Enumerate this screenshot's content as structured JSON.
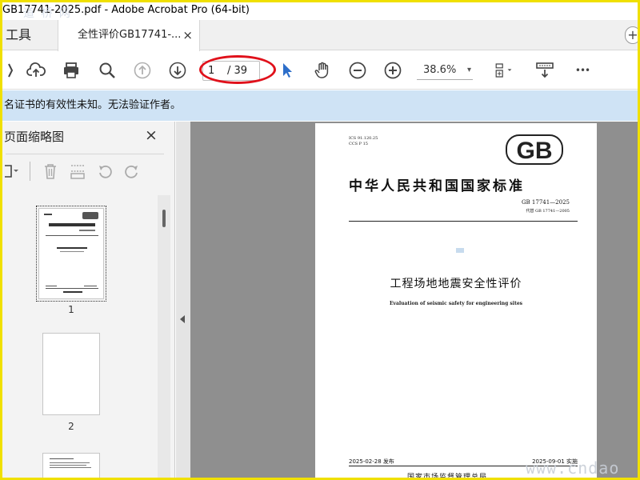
{
  "window": {
    "title": "GB17741-2025.pdf - Adobe Acrobat Pro (64-bit)",
    "watermark_top": "道 桥 网"
  },
  "tabs": {
    "tools_label": "工具",
    "doc_tab_label": "全性评价GB17741-...",
    "close_glyph": "×",
    "add_glyph": "+"
  },
  "toolbar": {
    "current_page": "1",
    "total_pages": "/ 39",
    "zoom": "38.6%",
    "caret": "▾",
    "more_glyph": "•••"
  },
  "infobar": {
    "message": "名证书的有效性未知。无法验证作者。"
  },
  "sidebar": {
    "title": "页面缩略图",
    "close_glyph": "×",
    "thumbnails": [
      {
        "label": "1"
      },
      {
        "label": "2"
      }
    ]
  },
  "document": {
    "ics": "ICS 91.120.25",
    "ccs": "CCS P 15",
    "logo_text": "GB",
    "standard_title": "中华人民共和国国家标准",
    "std_number": "GB 17741—2025",
    "replaces": "代替 GB 17741—2005",
    "title_cn": "工程场地地震安全性评价",
    "title_en": "Evaluation of seismic safety for engineering sites",
    "publish_date": "2025-02-28 发布",
    "implement_date": "2025-09-01 实施",
    "issuer": "国家市场监督管理总局"
  },
  "watermark_bottom": "www.cndao"
}
